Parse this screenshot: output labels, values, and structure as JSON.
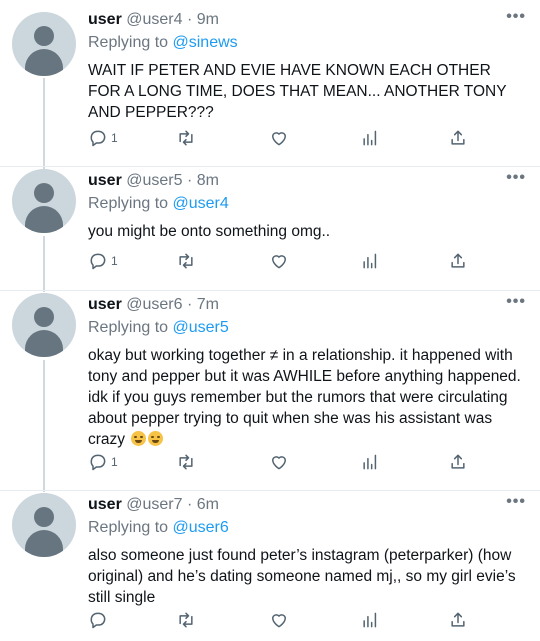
{
  "tweets": [
    {
      "name": "user",
      "handle": "@user4",
      "time": "9m",
      "replying_label": "Replying to",
      "replying_to": "@sinews",
      "text": "WAIT IF PETER AND EVIE HAVE KNOWN EACH OTHER FOR A LONG TIME, DOES THAT MEAN... ANOTHER TONY AND PEPPER???",
      "reply_count": "1",
      "emojis": []
    },
    {
      "name": "user",
      "handle": "@user5",
      "time": "8m",
      "replying_label": "Replying to",
      "replying_to": "@user4",
      "text": "you might be onto something omg..",
      "reply_count": "1",
      "emojis": []
    },
    {
      "name": "user",
      "handle": "@user6",
      "time": "7m",
      "replying_label": "Replying to",
      "replying_to": "@user5",
      "text": "okay but working together ≠ in a relationship. it happened with tony and pepper but it was AWHILE before anything happened. idk if you guys remember but the rumors that were circulating about pepper trying to quit when she was his assistant was crazy",
      "reply_count": "1",
      "emojis": [
        "grinning-sweat-emoji",
        "grinning-sweat-emoji"
      ]
    },
    {
      "name": "user",
      "handle": "@user7",
      "time": "6m",
      "replying_label": "Replying to",
      "replying_to": "@user6",
      "text": "also someone just found peter’s instagram (peterparker) (how original) and he’s dating someone named mj,, so my girl evie’s still single",
      "reply_count": "",
      "emojis": []
    }
  ],
  "separator": " · ",
  "more_label": "•••",
  "colors": {
    "link": "#1d9bf0",
    "secondary_text": "#6b7680",
    "icon": "#536471",
    "avatar_bg": "#ccd6dd",
    "avatar_fg": "#66757f",
    "thread_line": "#cfd9de"
  },
  "icons": [
    "reply-icon",
    "retweet-icon",
    "like-icon",
    "stats-icon",
    "share-icon",
    "more-icon"
  ]
}
